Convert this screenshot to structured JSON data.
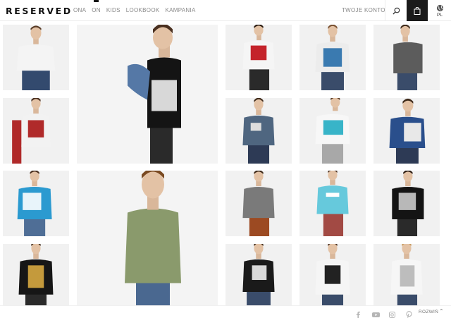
{
  "brand": {
    "logo": "RESERVED"
  },
  "nav": {
    "items": [
      {
        "label": "ONA"
      },
      {
        "label": "ON"
      },
      {
        "label": "KIDS"
      },
      {
        "label": "LOOKBOOK"
      },
      {
        "label": "KAMPANIA"
      }
    ],
    "active_index": 1
  },
  "header": {
    "account_label": "TWOJE KONTO",
    "language": "PL"
  },
  "footer": {
    "expand_label": "ROZWIŃ",
    "social_icons": [
      "facebook-icon",
      "youtube-icon",
      "instagram-icon",
      "pinterest-icon"
    ]
  },
  "products": [
    {
      "shirt": "#f4f4f4",
      "print": "",
      "jeans": "#334a6e",
      "hair": "#5a3d28"
    },
    {
      "shirt": "#141414",
      "print": "#d8d8d8",
      "jeans": "#2a2a2a",
      "hair": "#4a3020",
      "jacket": "#5578a6"
    },
    {
      "shirt": "#f5f5f5",
      "print": "#c4232b",
      "jeans": "#2a2a2a",
      "hair": "#2b1c12"
    },
    {
      "shirt": "#ececec",
      "print": "#3a7ab0",
      "jeans": "#3a4c6a",
      "hair": "#7a5232"
    },
    {
      "shirt": "#5c5c5c",
      "print": "",
      "jeans": "#3a4c6a",
      "hair": "#3e2a1a"
    },
    {
      "shirt": "#f2f2f2",
      "print": "#b02a2a",
      "jeans": "#b02a2a",
      "hair": "#4a3020"
    },
    {
      "shirt": "#4f6680",
      "print": "#dddddd",
      "jeans": "#2d3a55",
      "hair": "#3e2a1a"
    },
    {
      "shirt": "#f7f7f7",
      "print": "#38b4c8",
      "jeans": "#a8a8a8",
      "hair": "#5a3d28"
    },
    {
      "shirt": "#2a4f8c",
      "print": "#e8e8e8",
      "jeans": "#2d3a55",
      "hair": "#3e2a1a"
    },
    {
      "shirt": "#2b9ad0",
      "print": "#e8f4fa",
      "jeans": "#4f6e96",
      "hair": "#4a3020"
    },
    {
      "shirt": "#8a9a6c",
      "print": "",
      "jeans": "#4a6890",
      "hair": "#7a4a22"
    },
    {
      "shirt": "#7a7a7a",
      "print": "",
      "jeans": "#9c4a22",
      "hair": "#3e2a1a"
    },
    {
      "shirt": "#66c9dc",
      "print": "#ffffff",
      "jeans": "#a24a44",
      "hair": "#4a3020"
    },
    {
      "shirt": "#141414",
      "print": "#b8b8b8",
      "jeans": "#2a2a2a",
      "hair": "#2b1c12"
    },
    {
      "shirt": "#161616",
      "print": "#c49a3c",
      "jeans": "#2a2a2a",
      "hair": "#3e2a1a"
    },
    {
      "shirt": "#1a1a1a",
      "print": "#d8d8d8",
      "jeans": "#3a4c6a",
      "hair": "#3e2a1a"
    },
    {
      "shirt": "#f5f5f5",
      "print": "#222222",
      "jeans": "#3a4c6a",
      "hair": "#4a3020"
    },
    {
      "shirt": "#f6f6f6",
      "print": "#bdbdbd",
      "jeans": "#3a4c6a",
      "hair": "#c89a5a"
    }
  ]
}
